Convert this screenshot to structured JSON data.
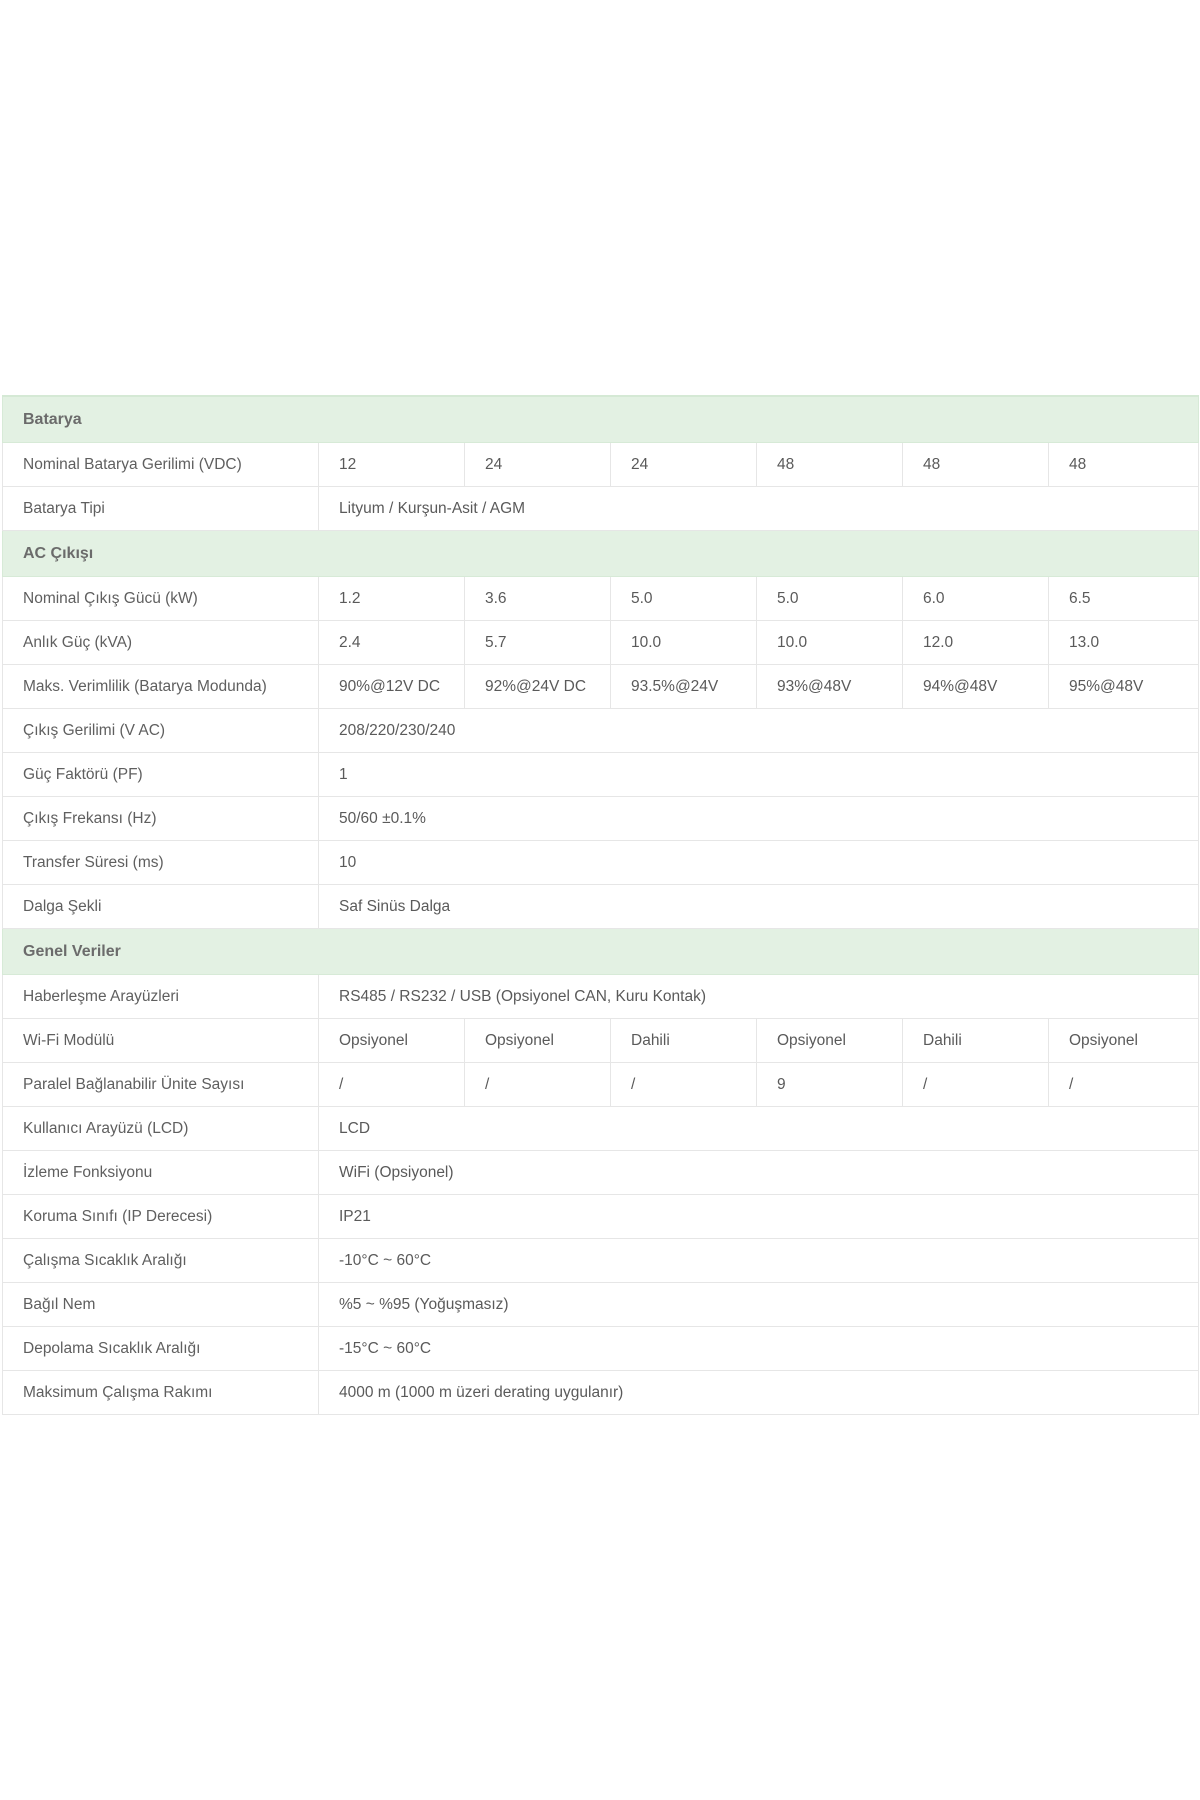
{
  "sections": [
    {
      "title": "Batarya",
      "rows": [
        {
          "label": "Nominal Batarya Gerilimi (VDC)",
          "values": [
            "12",
            "24",
            "24",
            "48",
            "48",
            "48"
          ]
        },
        {
          "label": "Batarya Tipi",
          "values": [
            "Lityum / Kurşun-Asit / AGM"
          ]
        }
      ]
    },
    {
      "title": "AC Çıkışı",
      "rows": [
        {
          "label": "Nominal Çıkış Gücü (kW)",
          "values": [
            "1.2",
            "3.6",
            "5.0",
            "5.0",
            "6.0",
            "6.5"
          ]
        },
        {
          "label": "Anlık Güç (kVA)",
          "values": [
            "2.4",
            "5.7",
            "10.0",
            "10.0",
            "12.0",
            "13.0"
          ]
        },
        {
          "label": "Maks. Verimlilik (Batarya Modunda)",
          "values": [
            "90%@12V DC",
            "92%@24V DC",
            "93.5%@24V",
            "93%@48V",
            "94%@48V",
            "95%@48V"
          ]
        },
        {
          "label": "Çıkış Gerilimi (V AC)",
          "values": [
            "208/220/230/240"
          ]
        },
        {
          "label": "Güç Faktörü (PF)",
          "values": [
            "1"
          ]
        },
        {
          "label": "Çıkış Frekansı (Hz)",
          "values": [
            "50/60 ±0.1%"
          ]
        },
        {
          "label": "Transfer Süresi (ms)",
          "values": [
            "10"
          ]
        },
        {
          "label": "Dalga Şekli",
          "values": [
            "Saf Sinüs Dalga"
          ]
        }
      ]
    },
    {
      "title": "Genel Veriler",
      "rows": [
        {
          "label": "Haberleşme Arayüzleri",
          "values": [
            "RS485 / RS232 / USB (Opsiyonel CAN, Kuru Kontak)"
          ]
        },
        {
          "label": "Wi-Fi Modülü",
          "values": [
            "Opsiyonel",
            "Opsiyonel",
            "Dahili",
            "Opsiyonel",
            "Dahili",
            "Opsiyonel"
          ]
        },
        {
          "label": "Paralel Bağlanabilir Ünite Sayısı",
          "values": [
            "/",
            "/",
            "/",
            "9",
            "/",
            "/"
          ]
        },
        {
          "label": "Kullanıcı Arayüzü (LCD)",
          "values": [
            "LCD"
          ]
        },
        {
          "label": "İzleme Fonksiyonu",
          "values": [
            "WiFi (Opsiyonel)"
          ]
        },
        {
          "label": "Koruma Sınıfı (IP Derecesi)",
          "values": [
            "IP21"
          ]
        },
        {
          "label": "Çalışma Sıcaklık Aralığı",
          "values": [
            "-10°C ~ 60°C"
          ]
        },
        {
          "label": "Bağıl Nem",
          "values": [
            "%5 ~ %95 (Yoğuşmasız)"
          ]
        },
        {
          "label": "Depolama Sıcaklık Aralığı",
          "values": [
            "-15°C ~ 60°C"
          ]
        },
        {
          "label": "Maksimum Çalışma Rakımı",
          "values": [
            "4000 m (1000 m üzeri derating uygulanır)"
          ]
        }
      ]
    }
  ],
  "colors": {
    "section_bg": "#e3f1e3",
    "border": "#e6e6e6",
    "text": "#5a5a5a"
  }
}
